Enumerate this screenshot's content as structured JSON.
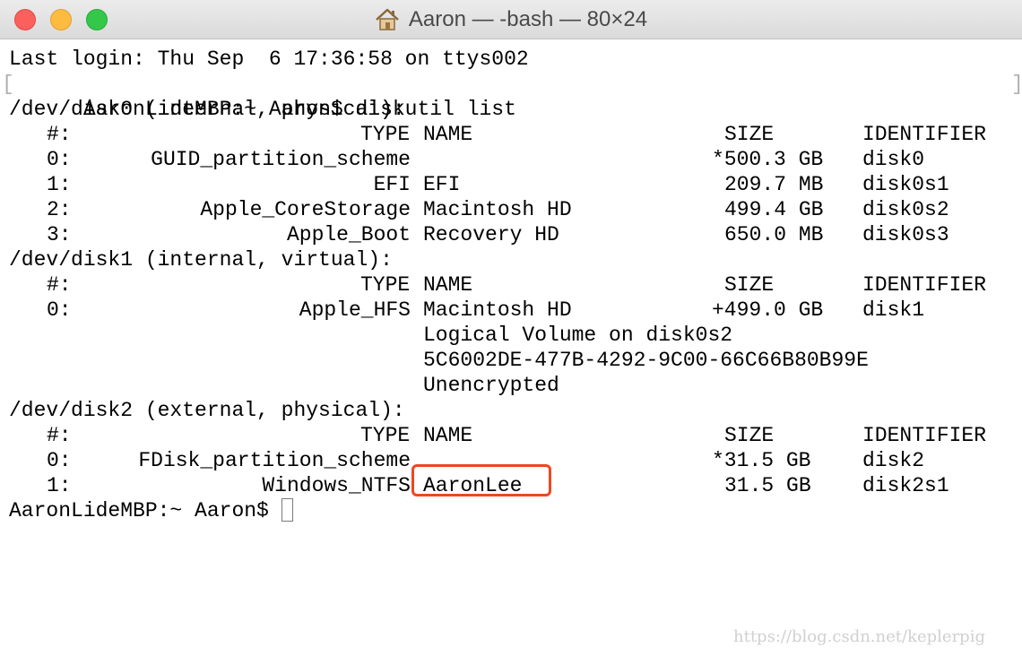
{
  "window": {
    "title": "Aaron — -bash — 80×24",
    "title_icon": "home-icon"
  },
  "terminal": {
    "last_login": "Last login: Thu Sep  6 17:36:58 on ttys002",
    "prompt1": "AaronLideMBP:~ Aaron$ diskutil list",
    "disks": [
      {
        "header": "/dev/disk0 (internal, physical):",
        "columns": {
          "num": "#:",
          "type": "TYPE",
          "name": "NAME",
          "size": "SIZE",
          "identifier": "IDENTIFIER"
        },
        "rows": [
          {
            "num": "0:",
            "type": "GUID_partition_scheme",
            "name": "",
            "size": "*500.3 GB",
            "identifier": "disk0"
          },
          {
            "num": "1:",
            "type": "EFI",
            "name": "EFI",
            "size": "209.7 MB",
            "identifier": "disk0s1"
          },
          {
            "num": "2:",
            "type": "Apple_CoreStorage",
            "name": "Macintosh HD",
            "size": "499.4 GB",
            "identifier": "disk0s2"
          },
          {
            "num": "3:",
            "type": "Apple_Boot",
            "name": "Recovery HD",
            "size": "650.0 MB",
            "identifier": "disk0s3"
          }
        ]
      },
      {
        "header": "/dev/disk1 (internal, virtual):",
        "columns": {
          "num": "#:",
          "type": "TYPE",
          "name": "NAME",
          "size": "SIZE",
          "identifier": "IDENTIFIER"
        },
        "rows": [
          {
            "num": "0:",
            "type": "Apple_HFS",
            "name": "Macintosh HD",
            "size": "+499.0 GB",
            "identifier": "disk1"
          }
        ],
        "extra": [
          "Logical Volume on disk0s2",
          "5C6002DE-477B-4292-9C00-66C66B80B99E",
          "Unencrypted"
        ]
      },
      {
        "header": "/dev/disk2 (external, physical):",
        "columns": {
          "num": "#:",
          "type": "TYPE",
          "name": "NAME",
          "size": "SIZE",
          "identifier": "IDENTIFIER"
        },
        "rows": [
          {
            "num": "0:",
            "type": "FDisk_partition_scheme",
            "name": "",
            "size": "*31.5 GB",
            "identifier": "disk2"
          },
          {
            "num": "1:",
            "type": "Windows_NTFS",
            "name": "AaronLee",
            "size": "31.5 GB",
            "identifier": "disk2s1"
          }
        ]
      }
    ],
    "prompt2": "AaronLideMBP:~ Aaron$ "
  },
  "watermark": "https://blog.csdn.net/keplerpig",
  "colors": {
    "highlight_border": "#ef4623",
    "close": "#fc605c",
    "minimize": "#fdbc40",
    "zoom": "#34c84a"
  }
}
